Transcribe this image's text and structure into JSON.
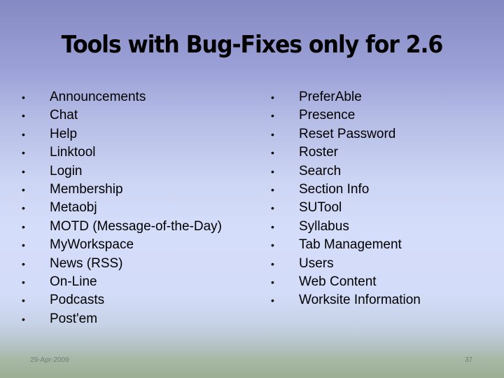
{
  "slide": {
    "title": "Tools with Bug-Fixes only for 2.6",
    "left_column": [
      "Announcements",
      "Chat",
      "Help",
      "Linktool",
      "Login",
      "Membership",
      "Metaobj",
      "MOTD (Message-of-the-Day)",
      "MyWorkspace",
      "News (RSS)",
      "On-Line",
      "Podcasts",
      "Post'em"
    ],
    "right_column": [
      "PreferAble",
      "Presence",
      "Reset Password",
      "Roster",
      "Search",
      "Section Info",
      "SUTool",
      "Syllabus",
      "Tab Management",
      "Users",
      "Web Content",
      "Worksite Information"
    ],
    "bullet_glyph": "•",
    "footer": {
      "date": "29-Apr-2009",
      "page_number": "37"
    }
  }
}
